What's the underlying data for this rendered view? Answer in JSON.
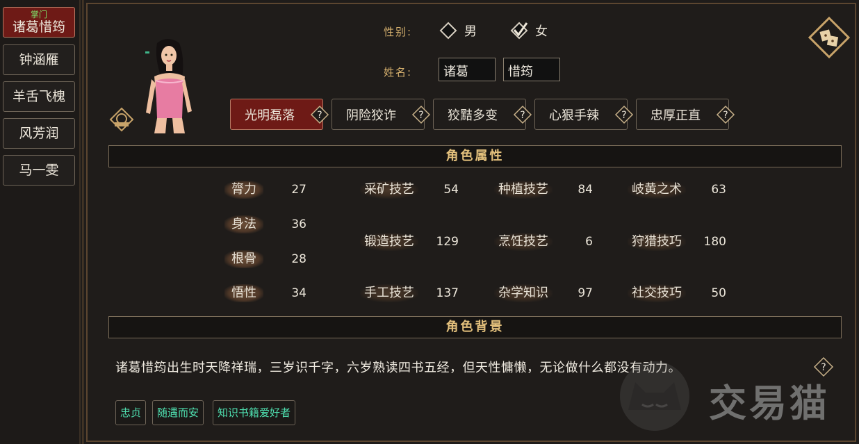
{
  "sidebar": {
    "items": [
      {
        "tag": "掌门",
        "label": "诸葛惜筠",
        "active": true
      },
      {
        "label": "钟涵雁"
      },
      {
        "label": "羊舌飞槐"
      },
      {
        "label": "风芳润"
      },
      {
        "label": "马一雯"
      }
    ]
  },
  "profile": {
    "gender_label": "性别:",
    "gender_options": [
      "男",
      "女"
    ],
    "gender_selected": "女",
    "name_label": "姓名:",
    "surname": "诸葛",
    "given_name": "惜筠"
  },
  "personality": {
    "options": [
      "光明磊落",
      "阴险狡诈",
      "狡黠多变",
      "心狠手辣",
      "忠厚正直"
    ],
    "selected": "光明磊落"
  },
  "attributes_title": "角色属性",
  "attributes": {
    "base": [
      {
        "name": "膂力",
        "value": "27"
      },
      {
        "name": "身法",
        "value": "36"
      },
      {
        "name": "根骨",
        "value": "28"
      },
      {
        "name": "悟性",
        "value": "34"
      }
    ],
    "skills": [
      {
        "name": "采矿技艺",
        "value": "54"
      },
      {
        "name": "种植技艺",
        "value": "84"
      },
      {
        "name": "岐黄之术",
        "value": "63"
      },
      {
        "name": "锻造技艺",
        "value": "129"
      },
      {
        "name": "烹饪技艺",
        "value": "6"
      },
      {
        "name": "狩猎技巧",
        "value": "180"
      },
      {
        "name": "手工技艺",
        "value": "137"
      },
      {
        "name": "杂学知识",
        "value": "97"
      },
      {
        "name": "社交技巧",
        "value": "50"
      }
    ]
  },
  "background_title": "角色背景",
  "background_text": "诸葛惜筠出生时天降祥瑞，三岁识千字，六岁熟读四书五经，但天性慵懒，无论做什么都没有动力。",
  "tags": [
    "忠贞",
    "随遇而安",
    "知识书籍爱好者"
  ],
  "watermark": "交易猫",
  "colors": {
    "accent_red": "#6e1a16",
    "gold": "#d8b26f",
    "tag_green": "#4fe0b0"
  }
}
